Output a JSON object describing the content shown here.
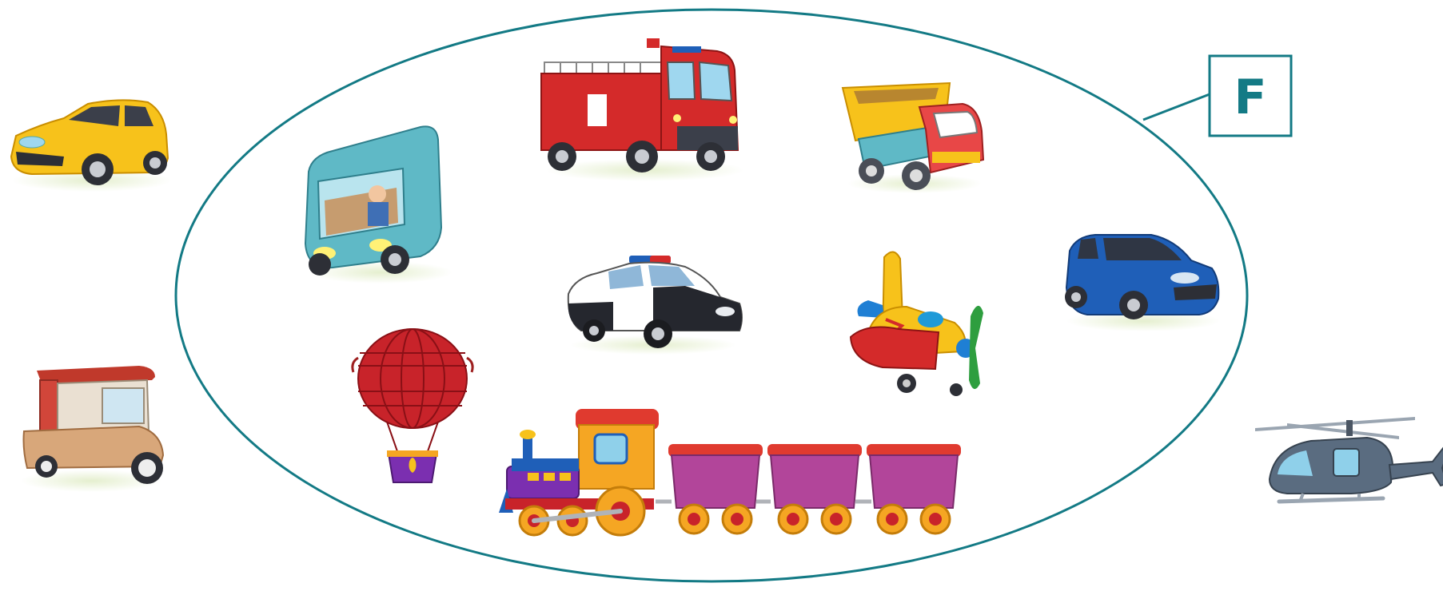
{
  "set": {
    "label": "F",
    "color": "#137a85"
  },
  "inside_set": [
    "bus-icon",
    "fire-truck-icon",
    "dump-truck-icon",
    "police-car-icon",
    "blue-car-icon",
    "hot-air-balloon-icon",
    "toy-airplane-icon",
    "toy-train-icon"
  ],
  "outside_set": [
    "yellow-car-icon",
    "auto-rickshaw-icon",
    "helicopter-icon"
  ],
  "colors": {
    "yellow": "#f7c21b",
    "red": "#d42a2a",
    "teal": "#5fb9c6",
    "blue": "#1f5fb8",
    "purple": "#b2459a",
    "orange": "#f5a623",
    "gray": "#5a6c80",
    "ground": "#e8f1d6"
  }
}
